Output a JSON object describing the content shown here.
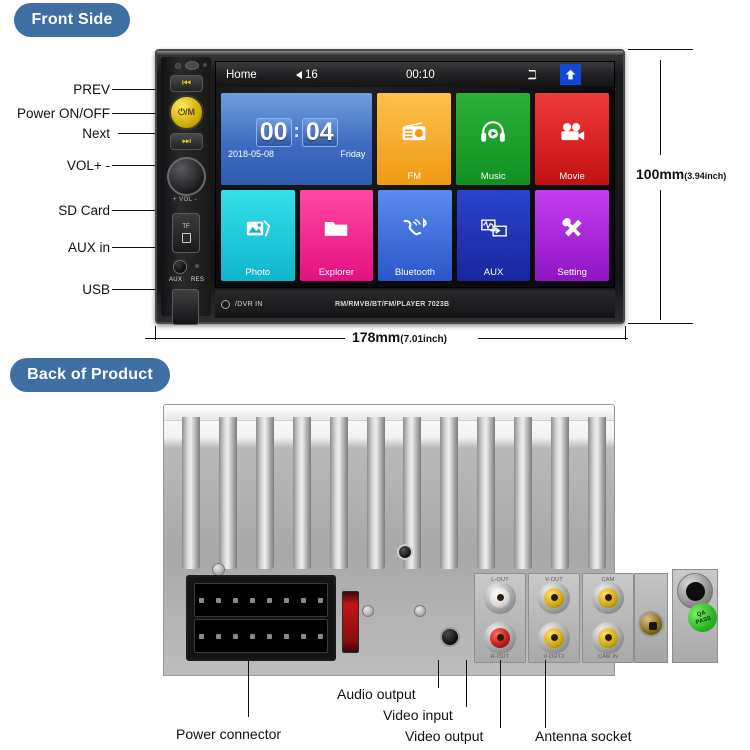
{
  "sections": {
    "front_badge": "Front Side",
    "back_badge": "Back of Product"
  },
  "front_callouts": [
    {
      "label": "PREV"
    },
    {
      "label": "Power ON/OFF"
    },
    {
      "label": "Next"
    },
    {
      "label": "VOL+ -"
    },
    {
      "label": "SD Card"
    },
    {
      "label": "AUX in"
    },
    {
      "label": "USB"
    }
  ],
  "dimensions": {
    "width_mm": "178mm",
    "width_inch": "(7.01inch)",
    "height_mm": "100mm",
    "height_inch": "(3.94inch)"
  },
  "bezel": {
    "prev_glyph": "⏮",
    "next_glyph": "⏭",
    "power_glyph": "⏻/M",
    "vol_text": "+ VOL -",
    "sd_text": "TF",
    "aux_text": "AUX",
    "res_text": "RES",
    "dvr_text": "/DVR IN",
    "model_text": "RM/RMVB/BT/FM/PLAYER 7023B"
  },
  "screen": {
    "statusbar": {
      "home": "Home",
      "volume": "16",
      "time": "00:10",
      "bluetooth_icon": "bluetooth-icon",
      "up_icon": "up-arrow-icon"
    },
    "clock_tile": {
      "hours": "00",
      "colon": ":",
      "minutes": "04",
      "date": "2018-05-08",
      "weekday": "Friday",
      "color": "#3f6cc0"
    },
    "tiles_row1": [
      {
        "label": "FM",
        "icon": "radio-icon",
        "glyph": "📻",
        "color": "#f5a623"
      },
      {
        "label": "Music",
        "icon": "headphones-icon",
        "glyph": "🎧",
        "color": "#1f9d2e"
      },
      {
        "label": "Movie",
        "icon": "movie-camera-icon",
        "glyph": "🎥",
        "color": "#e02020"
      }
    ],
    "tiles_row2": [
      {
        "label": "Photo",
        "icon": "photo-icon",
        "glyph": "🖼",
        "color": "#19c8d8"
      },
      {
        "label": "Explorer",
        "icon": "folder-icon",
        "glyph": "📁",
        "color": "#ef2b8c"
      },
      {
        "label": "Bluetooth",
        "icon": "phone-bluetooth-icon",
        "glyph": "📞",
        "color": "#3a6bd8"
      },
      {
        "label": "AUX",
        "icon": "aux-signal-icon",
        "glyph": "⇆",
        "color": "#1f35b8"
      },
      {
        "label": "Setting",
        "icon": "tools-icon",
        "glyph": "🔧",
        "color": "#a31fd8"
      }
    ]
  },
  "back_callouts": [
    {
      "label": "Audio output"
    },
    {
      "label": "Video input"
    },
    {
      "label": "Video output"
    },
    {
      "label": "Antenna socket"
    },
    {
      "label": "Power connector"
    }
  ],
  "back_panel": {
    "rca_blocks": [
      {
        "top_cap": "L-OUT",
        "bottom_cap": "R-OUT",
        "top_color": "white",
        "bottom_color": "red"
      },
      {
        "top_cap": "V-OUT",
        "bottom_cap": "V-OUT2",
        "top_color": "yellow",
        "bottom_color": "yellow"
      },
      {
        "top_cap": "CAM",
        "bottom_cap": "CAM IN",
        "top_color": "yellow",
        "bottom_color": "yellow"
      }
    ],
    "qa_sticker_line1": "QA",
    "qa_sticker_line2": "PASS",
    "qa_color": "#22aa1c"
  }
}
